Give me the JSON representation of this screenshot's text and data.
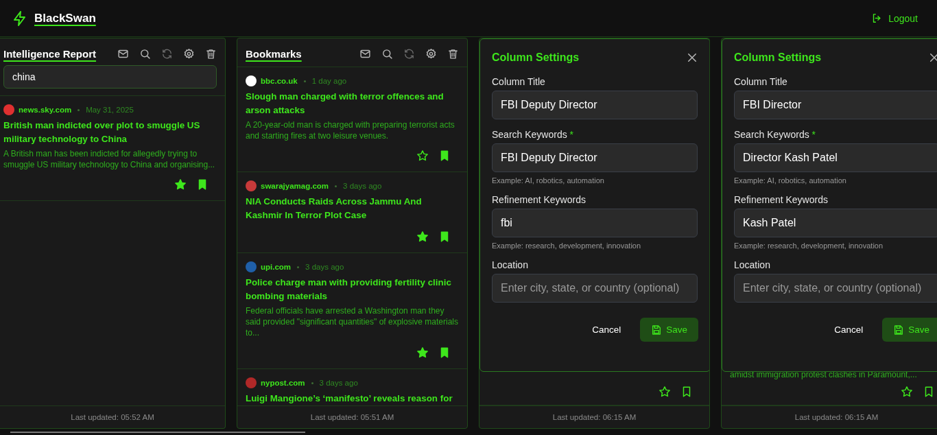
{
  "app": {
    "name": "BlackSwan",
    "logout": "Logout"
  },
  "columns": [
    {
      "title": "Intelligence Report",
      "search": {
        "value": "china"
      },
      "articles": [
        {
          "source": "news.sky.com",
          "color": "#e03030",
          "time": "May 31, 2025",
          "title": "British man indicted over plot to smuggle US military technology to China",
          "description": "A British man has been indicted for allegedly trying to smuggle US military technology to China and organising...",
          "starred": true,
          "bookmarked": true
        }
      ],
      "last_updated": "Last updated: 05:52 AM"
    },
    {
      "title": "Bookmarks",
      "articles": [
        {
          "source": "bbc.co.uk",
          "color": "#ffffff",
          "time": "1 day ago",
          "title": "Slough man charged with terror offences and arson attacks",
          "description": "A 20-year-old man is charged with preparing terrorist acts and starting fires at two leisure venues.",
          "starred": false,
          "bookmarked": true
        },
        {
          "source": "swarajyamag.com",
          "color": "#c83a3a",
          "time": "3 days ago",
          "title": "NIA Conducts Raids Across Jammu And Kashmir In Terror Plot Case",
          "starred": true,
          "bookmarked": true
        },
        {
          "source": "upi.com",
          "color": "#1f5fa8",
          "time": "3 days ago",
          "title": "Police charge man with providing fertility clinic bombing materials",
          "description": "Federal officials have arrested a Washington man they said provided \"significant quantities\" of explosive materials to...",
          "starred": true,
          "bookmarked": true
        },
        {
          "source": "nypost.com",
          "color": "#b02828",
          "time": "3 days ago",
          "title": "Luigi Mangione’s ‘manifesto’ reveals reason for"
        }
      ],
      "last_updated": "Last updated: 05:51 AM"
    },
    {
      "settings": {
        "title": "Column Settings",
        "fields": [
          {
            "label": "Column Title",
            "value": "FBI Deputy Director"
          },
          {
            "label": "Search Keywords",
            "required_mark": "*",
            "value": "FBI Deputy Director",
            "hint": "Example: AI, robotics, automation"
          },
          {
            "label": "Refinement Keywords",
            "value": "fbi",
            "hint": "Example: research, development, innovation"
          },
          {
            "label": "Location",
            "placeholder": "Enter city, state, or country (optional)"
          }
        ],
        "cancel": "Cancel",
        "save": "Save"
      },
      "articles": [
        {
          "starred": false,
          "bookmarked": false
        }
      ],
      "last_updated": "Last updated: 06:15 AM"
    },
    {
      "settings": {
        "title": "Column Settings",
        "fields": [
          {
            "label": "Column Title",
            "value": "FBI Director"
          },
          {
            "label": "Search Keywords",
            "required_mark": "*",
            "value": "Director Kash Patel",
            "hint": "Example: AI, robotics, automation"
          },
          {
            "label": "Refinement Keywords",
            "value": "Kash Patel",
            "hint": "Example: research, development, innovation"
          },
          {
            "label": "Location",
            "placeholder": "Enter city, state, or country (optional)"
          }
        ],
        "cancel": "Cancel",
        "save": "Save"
      },
      "articles": [
        {
          "description": "amidst immigration protest clashes in Paramount,...",
          "starred": false,
          "bookmarked": false
        }
      ],
      "last_updated": "Last updated: 06:15 AM"
    }
  ]
}
